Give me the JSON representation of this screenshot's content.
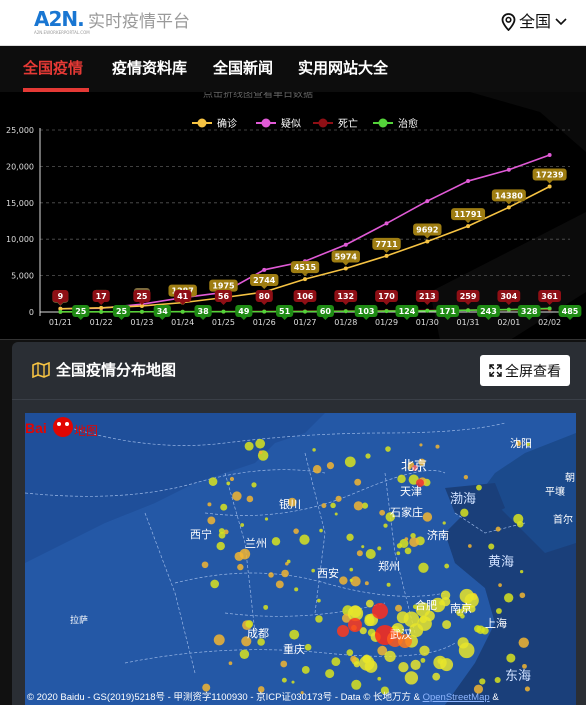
{
  "header": {
    "logo_text": "A2N.",
    "logo_sub": "A2N.EWORKERPORTAL.COM",
    "title": "实时疫情平台",
    "region": "全国"
  },
  "nav": {
    "tabs": [
      "全国疫情",
      "疫情资料库",
      "全国新闻",
      "实用网站大全"
    ],
    "active_index": 0
  },
  "chart": {
    "hint": "点击折线图查看单日数据",
    "legend": [
      "确诊",
      "疑似",
      "死亡",
      "治愈"
    ]
  },
  "chart_data": {
    "type": "line",
    "x": [
      "01/21",
      "01/22",
      "01/23",
      "01/24",
      "01/25",
      "01/26",
      "01/27",
      "01/28",
      "01/29",
      "01/30",
      "01/31",
      "02/01",
      "02/02"
    ],
    "ylim": [
      0,
      25000
    ],
    "yticks": [
      "0",
      "5,000",
      "10,000",
      "15,000",
      "20,000",
      "25,000"
    ],
    "grid": true,
    "legend_position": "top",
    "series": [
      {
        "name": "确诊",
        "color": "#f6c343",
        "label_color": "#9e7d12",
        "values": [
          440,
          571,
          830,
          1287,
          1975,
          2744,
          4515,
          5974,
          7711,
          9692,
          11791,
          14380,
          17239
        ],
        "labels": [
          null,
          null,
          null,
          "1287",
          "1975",
          "2744",
          "4515",
          "5974",
          "7711",
          "9692",
          "11791",
          "14380",
          "17239"
        ]
      },
      {
        "name": "疑似",
        "color": "#e05ad6",
        "label_color": "#8e8e8e",
        "values": [
          440,
          530,
          1072,
          1965,
          2684,
          5794,
          6973,
          9239,
          12167,
          15238,
          17988,
          19544,
          21558
        ],
        "labels": [
          null,
          null,
          null,
          null,
          null,
          null,
          null,
          null,
          null,
          null,
          null,
          null,
          null
        ]
      },
      {
        "name": "死亡",
        "color": "#8e0f15",
        "label_color": "#8e0f15",
        "values": [
          9,
          17,
          25,
          41,
          56,
          80,
          106,
          132,
          170,
          213,
          259,
          304,
          361
        ],
        "labels": [
          "9",
          "17",
          "25",
          "41",
          "56",
          "80",
          "106",
          "132",
          "170",
          "213",
          "259",
          "304",
          "361"
        ]
      },
      {
        "name": "治愈",
        "color": "#54d23a",
        "label_color": "#1f8b14",
        "values": [
          25,
          25,
          34,
          38,
          49,
          51,
          60,
          103,
          124,
          171,
          243,
          328,
          485
        ],
        "labels": [
          "25",
          "25",
          "34",
          "38",
          "49",
          "51",
          "60",
          "103",
          "124",
          "171",
          "243",
          "328",
          "485"
        ]
      }
    ]
  },
  "map": {
    "title": "全国疫情分布地图",
    "fullscreen_label": "全屏查看",
    "cities": [
      {
        "name": "沈阳"
      },
      {
        "name": "北京"
      },
      {
        "name": "天津"
      },
      {
        "name": "石家庄"
      },
      {
        "name": "银川"
      },
      {
        "name": "兰州"
      },
      {
        "name": "西宁"
      },
      {
        "name": "济南"
      },
      {
        "name": "渤海"
      },
      {
        "name": "黄海"
      },
      {
        "name": "西安"
      },
      {
        "name": "郑州"
      },
      {
        "name": "合肥"
      },
      {
        "name": "南京"
      },
      {
        "name": "上海"
      },
      {
        "name": "武汉"
      },
      {
        "name": "成都"
      },
      {
        "name": "重庆"
      },
      {
        "name": "拉萨"
      },
      {
        "name": "平壤"
      },
      {
        "name": "首尔"
      },
      {
        "name": "东海"
      },
      {
        "name": "朝"
      }
    ],
    "credit": "© 2020 Baidu - GS(2019)5218号 - 甲测资字1100930 - 京ICP证030173号 - Data © 长地万方 &",
    "credit_link": "OpenStreetMap",
    "credit_tail": "&",
    "baidu_logo_text": "Bai",
    "baidu_logo_map": "地图"
  }
}
